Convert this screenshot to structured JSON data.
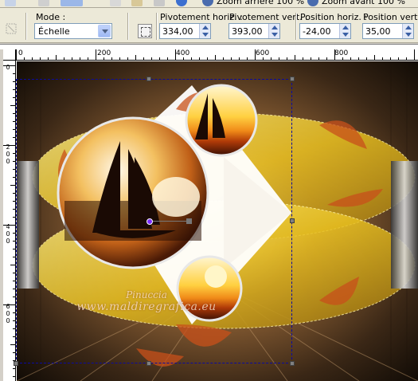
{
  "top_toolbar": {
    "zoom_out_label": "Zoom arrière 100 %",
    "zoom_in_label": "Zoom avant 100 %"
  },
  "options": {
    "mode": {
      "label": "Mode :",
      "value": "Échelle"
    },
    "pivot_h": {
      "label": "Pivotement horiz. :",
      "value": "334,00"
    },
    "pivot_v": {
      "label": "Pivotement vert. :",
      "value": "393,00"
    },
    "pos_h": {
      "label": "Position horiz. :",
      "value": "-24,00"
    },
    "pos_v": {
      "label": "Position vert. :",
      "value": "35,00"
    }
  },
  "ruler": {
    "h_labels": [
      "0",
      "200",
      "400",
      "600",
      "800"
    ],
    "v_labels": [
      "0",
      "2\n0\n0",
      "4\n0\n0",
      "6\n0\n0"
    ]
  },
  "canvas": {
    "watermark_line1": "Pinuccia",
    "watermark_line2": "www.maldiregrafica.eu"
  },
  "colors": {
    "accent_yellow": "#e8c020",
    "sunset_orange": "#f09020",
    "background_dark": "#2a1d10",
    "selection": "#0a0aa0"
  }
}
